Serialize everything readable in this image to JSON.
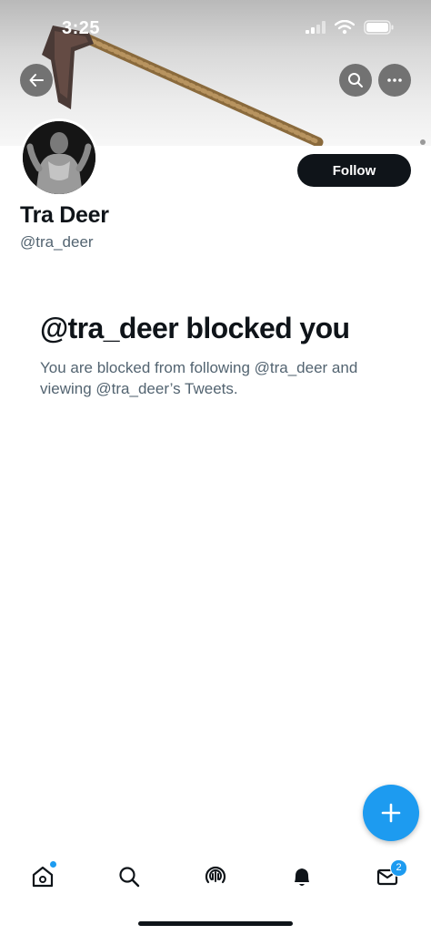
{
  "status_bar": {
    "time": "3:25"
  },
  "header": {
    "back_icon": "arrow-left-icon",
    "search_icon": "search-icon",
    "more_icon": "more-icon"
  },
  "profile": {
    "name": "Tra Deer",
    "handle": "@tra_deer",
    "follow_label": "Follow"
  },
  "blocked": {
    "title": "@tra_deer blocked you",
    "description": "You are blocked from following @tra_deer and viewing @tra_deer’s Tweets."
  },
  "tab_bar": {
    "items": [
      {
        "icon": "home-icon",
        "has_dot": true
      },
      {
        "icon": "search-icon"
      },
      {
        "icon": "spaces-icon"
      },
      {
        "icon": "bell-icon"
      },
      {
        "icon": "mail-icon",
        "badge": "2"
      }
    ]
  },
  "colors": {
    "accent": "#1d9bf0",
    "text": "#0f1419",
    "secondary": "#536471"
  }
}
